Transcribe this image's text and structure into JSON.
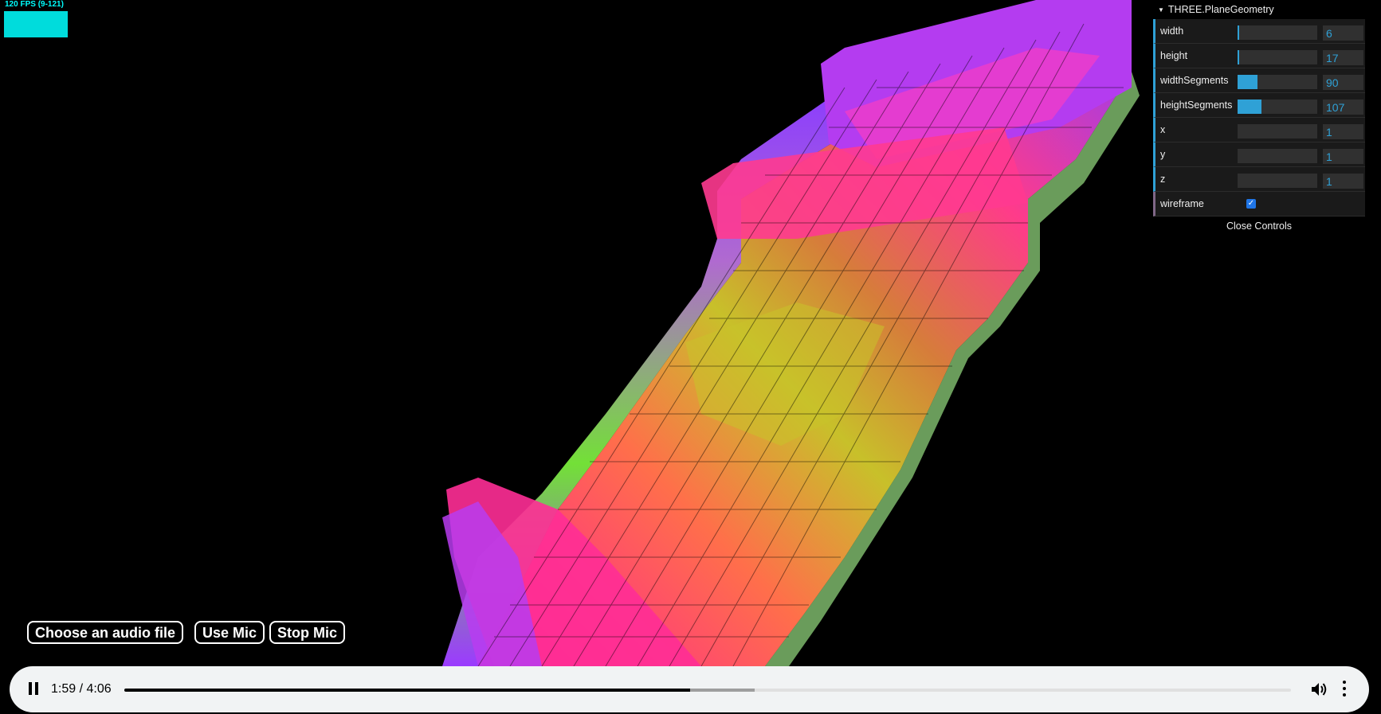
{
  "stats": {
    "fps_label": "120 FPS (9-121)"
  },
  "gui": {
    "title": "THREE.PlaneGeometry",
    "controls": [
      {
        "label": "width",
        "value": "6",
        "fill": 0.02
      },
      {
        "label": "height",
        "value": "17",
        "fill": 0.02
      },
      {
        "label": "widthSegments",
        "value": "90",
        "fill": 0.25
      },
      {
        "label": "heightSegments",
        "value": "107",
        "fill": 0.3
      },
      {
        "label": "x",
        "value": "1",
        "fill": 0
      },
      {
        "label": "y",
        "value": "1",
        "fill": 0
      },
      {
        "label": "z",
        "value": "1",
        "fill": 0
      }
    ],
    "wireframe_label": "wireframe",
    "wireframe_checked": true,
    "close_label": "Close Controls"
  },
  "audio_buttons": {
    "choose_file": "Choose an audio file",
    "use_mic": "Use Mic",
    "stop_mic": "Stop Mic"
  },
  "player": {
    "time": "1:59 / 4:06",
    "played_fraction": 0.485,
    "buffered_fraction": 0.54,
    "play_icon": "pause-icon",
    "volume_icon": "volume-icon",
    "menu_icon": "more-vert-icon"
  }
}
